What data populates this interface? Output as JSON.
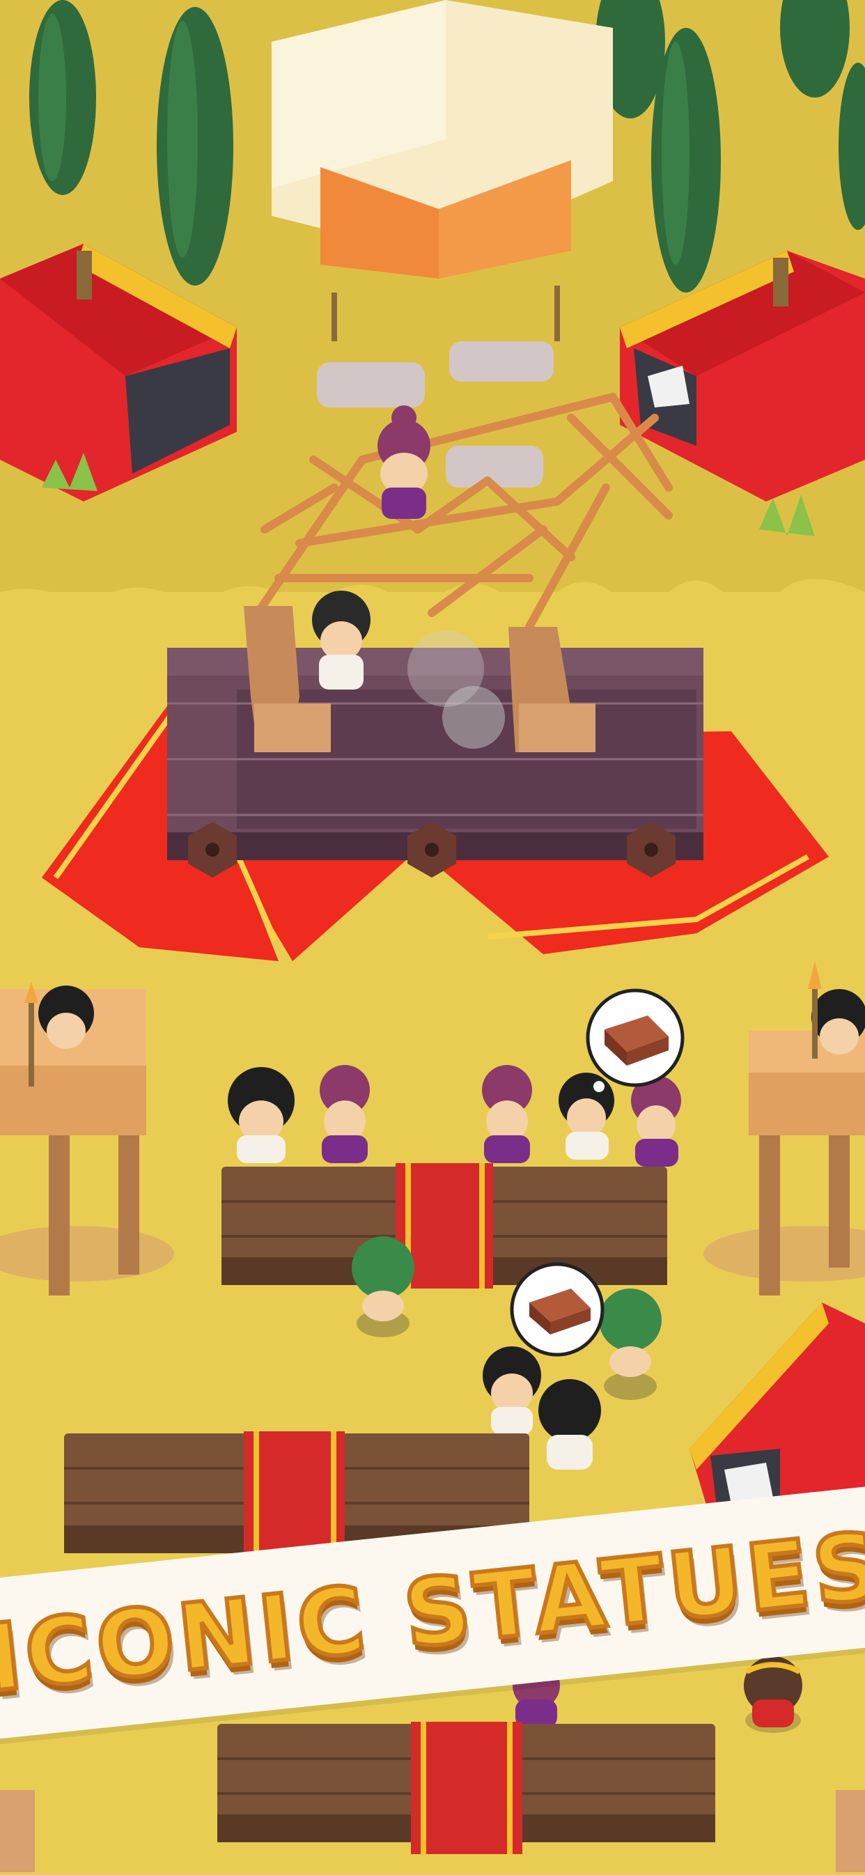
{
  "banner": {
    "text": "ICONIC STATUES"
  },
  "speech_bubbles": [
    {
      "item": "wood-plank-icon"
    },
    {
      "item": "wood-plank-icon"
    }
  ],
  "colors": {
    "grass": "#e9cd52",
    "grass_dark": "#dcc046",
    "tent_red": "#e2262b",
    "tent_gold": "#f2c12c",
    "carpet_red": "#ef2a1e",
    "platform": "#6e4a5c",
    "wood_table": "#7a5238",
    "tree": "#2f6a3c",
    "banner_bg": "#fdf8ef",
    "banner_text": "#f4b72a"
  }
}
